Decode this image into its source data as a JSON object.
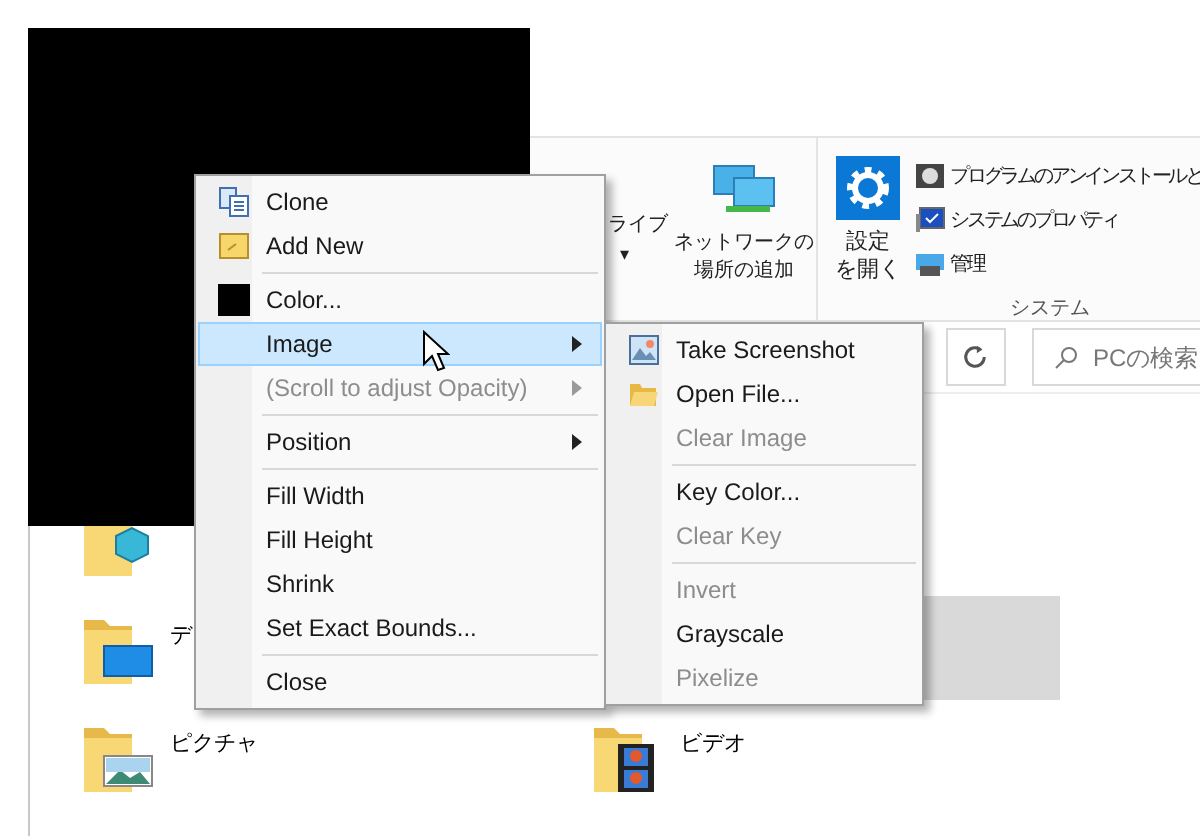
{
  "ribbon": {
    "partial_button": {
      "label": "ライブ",
      "caret": "▾"
    },
    "network_button": {
      "lines": [
        "ネットワークの",
        "場所の追加"
      ]
    },
    "settings_button": {
      "lines": [
        "設定",
        "を開く"
      ]
    },
    "system_items": [
      {
        "kind": "programs",
        "label": "プログラムのアンインストールと"
      },
      {
        "kind": "properties",
        "label": "システムのプロパティ"
      },
      {
        "kind": "manage",
        "label": "管理"
      }
    ],
    "group_label": "システム"
  },
  "address_bar": {
    "search": {
      "placeholder": "PCの検索"
    }
  },
  "folders": [
    [
      {
        "kind": "cube",
        "selected": false
      }
    ],
    [
      {
        "kind": "desktop",
        "label": "デ",
        "selected": false
      },
      {
        "kind": "covered",
        "selected": true
      }
    ],
    [
      {
        "kind": "pictures",
        "label": "ピクチャ",
        "selected": false
      },
      {
        "kind": "videos",
        "label": "ビデオ",
        "selected": false
      }
    ]
  ],
  "context_menu": [
    {
      "kind": "clone",
      "label": "Clone",
      "disabled": false,
      "selected": false
    },
    {
      "kind": "add",
      "label": "Add New",
      "disabled": false,
      "selected": false
    },
    {
      "kind": "separator"
    },
    {
      "kind": "color",
      "label": "Color...",
      "disabled": false,
      "selected": false
    },
    {
      "kind": "submenu",
      "label": "Image",
      "disabled": false,
      "selected": true
    },
    {
      "kind": "submenu",
      "label": "(Scroll to adjust Opacity)",
      "disabled": true,
      "selected": false
    },
    {
      "kind": "separator"
    },
    {
      "kind": "submenu",
      "label": "Position",
      "disabled": false,
      "selected": false
    },
    {
      "kind": "separator"
    },
    {
      "kind": "item",
      "label": "Fill Width",
      "disabled": false,
      "selected": false
    },
    {
      "kind": "item",
      "label": "Fill Height",
      "disabled": false,
      "selected": false
    },
    {
      "kind": "item",
      "label": "Shrink",
      "disabled": false,
      "selected": false
    },
    {
      "kind": "item",
      "label": "Set Exact Bounds...",
      "disabled": false,
      "selected": false
    },
    {
      "kind": "separator"
    },
    {
      "kind": "item",
      "label": "Close",
      "disabled": false,
      "selected": false
    }
  ],
  "image_submenu": [
    {
      "kind": "screenshot",
      "label": "Take Screenshot",
      "disabled": false,
      "selected": false
    },
    {
      "kind": "open",
      "label": "Open File...",
      "disabled": false,
      "selected": false
    },
    {
      "kind": "item",
      "label": "Clear Image",
      "disabled": true,
      "selected": false
    },
    {
      "kind": "separator"
    },
    {
      "kind": "item",
      "label": "Key Color...",
      "disabled": false,
      "selected": false
    },
    {
      "kind": "item",
      "label": "Clear Key",
      "disabled": true,
      "selected": false
    },
    {
      "kind": "separator"
    },
    {
      "kind": "item",
      "label": "Invert",
      "disabled": true,
      "selected": false
    },
    {
      "kind": "item",
      "label": "Grayscale",
      "disabled": false,
      "selected": false
    },
    {
      "kind": "item",
      "label": "Pixelize",
      "disabled": true,
      "selected": false
    }
  ]
}
